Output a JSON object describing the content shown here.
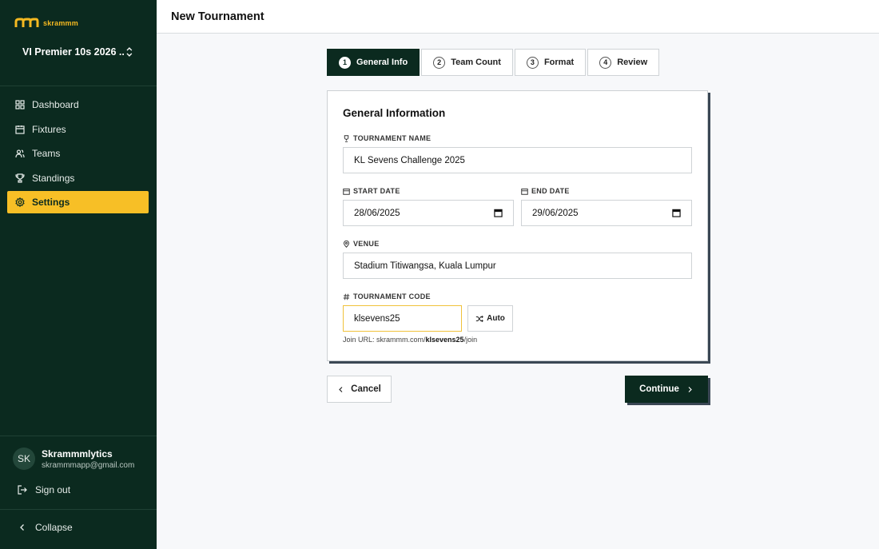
{
  "app": {
    "logo_text": "skrammm",
    "accent": "#f7bf26",
    "sidebar_bg": "#0b2a1f"
  },
  "sidebar": {
    "org_name": "VI Premier 10s 2026 ...",
    "items": [
      {
        "label": "Dashboard",
        "icon": "grid-icon",
        "active": false
      },
      {
        "label": "Fixtures",
        "icon": "calendar-icon",
        "active": false
      },
      {
        "label": "Teams",
        "icon": "users-icon",
        "active": false
      },
      {
        "label": "Standings",
        "icon": "trophy-icon",
        "active": false
      },
      {
        "label": "Settings",
        "icon": "gear-icon",
        "active": true
      }
    ],
    "user": {
      "initials": "SK",
      "name": "Skrammmlytics",
      "email": "skrammmapp@gmail.com"
    },
    "sign_out": "Sign out",
    "collapse": "Collapse"
  },
  "header": {
    "title": "New Tournament"
  },
  "stepper": [
    {
      "num": "1",
      "label": "General Info",
      "active": true
    },
    {
      "num": "2",
      "label": "Team Count",
      "active": false
    },
    {
      "num": "3",
      "label": "Format",
      "active": false
    },
    {
      "num": "4",
      "label": "Review",
      "active": false
    }
  ],
  "form": {
    "title": "General Information",
    "tournament_name": {
      "label": "TOURNAMENT NAME",
      "value": "KL Sevens Challenge 2025"
    },
    "start_date": {
      "label": "START DATE",
      "value": "28/06/2025"
    },
    "end_date": {
      "label": "END DATE",
      "value": "29/06/2025"
    },
    "venue": {
      "label": "VENUE",
      "value": "Stadium Titiwangsa, Kuala Lumpur"
    },
    "code": {
      "label": "TOURNAMENT CODE",
      "value": "klsevens25",
      "auto_label": "Auto"
    },
    "join_url": {
      "prefix": "Join URL: skrammm.com/",
      "code": "klsevens25",
      "suffix": "/join"
    }
  },
  "actions": {
    "cancel": "Cancel",
    "continue": "Continue"
  }
}
